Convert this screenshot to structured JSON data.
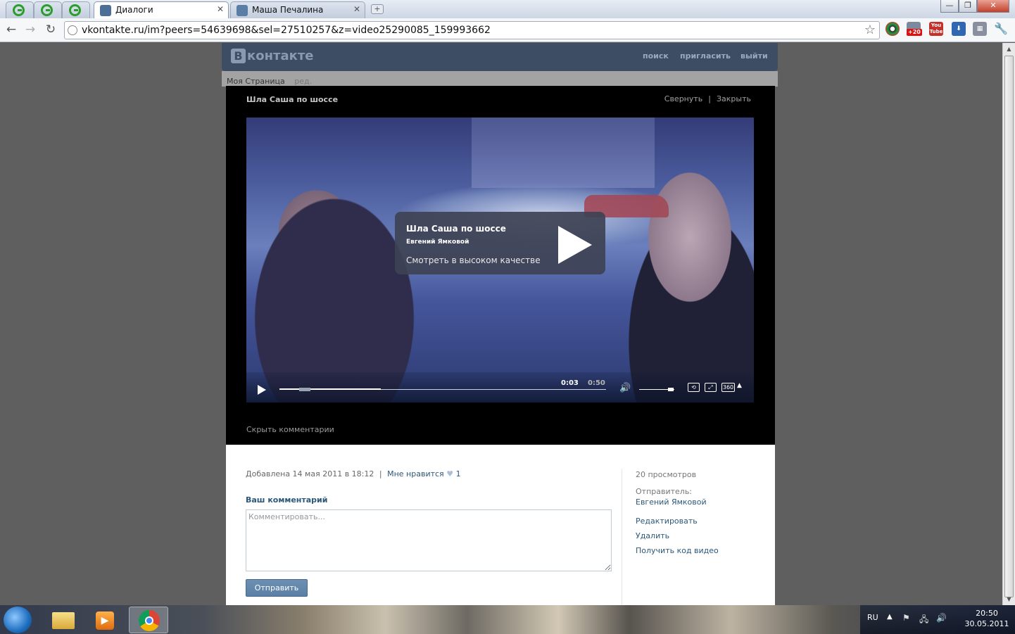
{
  "browser": {
    "tabs": [
      {
        "title": ""
      },
      {
        "title": ""
      },
      {
        "title": ""
      },
      {
        "title": "Диалоги"
      },
      {
        "title": "Маша Печалина"
      }
    ],
    "address": "vkontakte.ru/im?peers=54639698&sel=27510257&z=video25290085_159993662",
    "extensions": [
      {
        "icon": "color-picker-icon"
      },
      {
        "icon": "notifier-icon",
        "badge": "+20"
      },
      {
        "icon": "youtube-icon",
        "label": "You Tube"
      },
      {
        "icon": "download-icon"
      },
      {
        "icon": "apps-grid-icon"
      },
      {
        "icon": "wrench-icon"
      }
    ]
  },
  "vk": {
    "logo": "контакте",
    "logo_letter": "В",
    "nav": {
      "search": "поиск",
      "invite": "пригласить",
      "logout": "выйти"
    },
    "left": {
      "my_page": "Моя Страница",
      "edit": "ред."
    }
  },
  "video": {
    "title": "Шла Саша по шоссе",
    "collapse": "Свернуть",
    "close": "Закрыть",
    "separator": "|",
    "overlay": {
      "title": "Шла Саша по шоссе",
      "author": "Евгений Ямковой",
      "hq": "Смотреть в высоком качестве"
    },
    "controls": {
      "current_time": "0:03",
      "duration": "0:50",
      "progress": 0.06,
      "buffered": 0.31,
      "volume": 0.9,
      "quality": "360"
    },
    "hide_comments": "Скрыть комментарии"
  },
  "info": {
    "added": "Добавлена 14 мая 2011 в 18:12",
    "sep": "|",
    "like": "Мне нравится",
    "likes": "1",
    "comment_label": "Ваш комментарий",
    "comment_placeholder": "Комментировать...",
    "send": "Отправить",
    "views": "20 просмотров",
    "sender_label": "Отправитель:",
    "sender": "Евгений Ямковой",
    "edit": "Редактировать",
    "delete": "Удалить",
    "get_code": "Получить код видео"
  },
  "taskbar": {
    "lang": "RU",
    "time": "20:50",
    "date": "30.05.2011"
  },
  "colors": {
    "vk_blue": "#2b587a",
    "header": "#3d4d64",
    "button": "#5b7fa6"
  }
}
